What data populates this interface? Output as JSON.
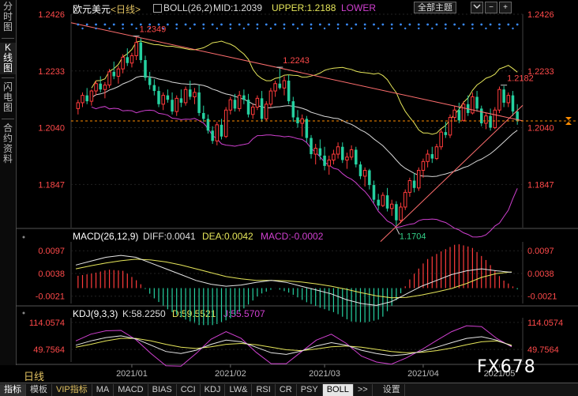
{
  "left_tabs": [
    {
      "label": "分时图",
      "active": false
    },
    {
      "label": "K线图",
      "active": true
    },
    {
      "label": "闪电图",
      "active": false
    },
    {
      "label": "合约资料",
      "active": false
    }
  ],
  "header": {
    "symbol": "欧元美元",
    "period": "<日线>",
    "indicator": "BOLL(26,2)",
    "mid_label": "MID:1.2039",
    "upper_label": "UPPER:1.2188",
    "lower_label": "LOWER",
    "theme_button": "全部主题",
    "down_icon": "chevron-down-icon",
    "btn_minus": "−",
    "btn_plus": "+"
  },
  "macd_header": {
    "name": "MACD(26,12,9)",
    "diff": "DIFF:0.0041",
    "dea": "DEA:0.0042",
    "macd": "MACD:-0.0002"
  },
  "kdj_header": {
    "name": "KDJ(9,3,3)",
    "k": "K:58.2250",
    "d": "D:59.5521",
    "j": "J:55.5707"
  },
  "footer": {
    "period": "日线",
    "tabs": [
      "指标",
      "模板",
      "VIP指标",
      "MA",
      "MACD",
      "BIAS",
      "CCI",
      "KDJ",
      "LW&",
      "RSI",
      "CR",
      "PSY",
      "BOLL",
      ">>",
      "设置"
    ],
    "active_tab": "BOLL"
  },
  "watermark": "FX678",
  "colors": {
    "up": "#ff3b3b",
    "down": "#25d0a0",
    "upper": "#e6e65a",
    "mid": "#d8d8d8",
    "lower": "#d040d0",
    "trend": "#ff6e6e",
    "price_line": "#ff8c00",
    "label_red": "#ff4a4a",
    "label_green": "#33d088",
    "dea": "#e6e65a",
    "diff": "#e6e6e6",
    "kdj_k": "#e6e6e6",
    "kdj_d": "#e6e65a",
    "kdj_j": "#d040d0"
  },
  "chart_data": [
    {
      "type": "candlestick",
      "title": "欧元美元 <日线>",
      "ylim": [
        1.17,
        1.2426
      ],
      "y_ticks": [
        1.2426,
        1.2233,
        1.204,
        1.1847
      ],
      "x_ticks": [
        "2021/01",
        "2021/02",
        "2021/03",
        "2021/04",
        "2021/05"
      ],
      "current_price": 1.2063,
      "annotations": [
        {
          "text": "1.2349",
          "value": 1.2349,
          "kind": "high"
        },
        {
          "text": "1.2243",
          "value": 1.2243,
          "kind": "high"
        },
        {
          "text": "1.2182",
          "value": 1.2182,
          "kind": "high"
        },
        {
          "text": "1.1704",
          "value": 1.1704,
          "kind": "low"
        }
      ],
      "ohlc": [
        [
          1.2105,
          1.2135,
          1.2085,
          1.2125
        ],
        [
          1.2125,
          1.216,
          1.211,
          1.215
        ],
        [
          1.215,
          1.2175,
          1.212,
          1.213
        ],
        [
          1.213,
          1.217,
          1.2115,
          1.2165
        ],
        [
          1.2165,
          1.22,
          1.215,
          1.219
        ],
        [
          1.219,
          1.2215,
          1.216,
          1.217
        ],
        [
          1.217,
          1.2195,
          1.214,
          1.2185
        ],
        [
          1.2185,
          1.224,
          1.2175,
          1.223
        ],
        [
          1.223,
          1.2265,
          1.2205,
          1.2215
        ],
        [
          1.2215,
          1.225,
          1.219,
          1.224
        ],
        [
          1.224,
          1.229,
          1.2225,
          1.228
        ],
        [
          1.228,
          1.231,
          1.225,
          1.226
        ],
        [
          1.226,
          1.2295,
          1.2245,
          1.2285
        ],
        [
          1.2285,
          1.2349,
          1.227,
          1.233
        ],
        [
          1.233,
          1.2345,
          1.226,
          1.227
        ],
        [
          1.227,
          1.2285,
          1.22,
          1.221
        ],
        [
          1.221,
          1.223,
          1.217,
          1.2185
        ],
        [
          1.2185,
          1.2205,
          1.215,
          1.2165
        ],
        [
          1.2165,
          1.218,
          1.211,
          1.212
        ],
        [
          1.212,
          1.216,
          1.21,
          1.215
        ],
        [
          1.215,
          1.217,
          1.2125,
          1.2135
        ],
        [
          1.2135,
          1.216,
          1.2085,
          1.2095
        ],
        [
          1.2095,
          1.215,
          1.208,
          1.214
        ],
        [
          1.214,
          1.217,
          1.211,
          1.2125
        ],
        [
          1.2125,
          1.218,
          1.2115,
          1.217
        ],
        [
          1.217,
          1.22,
          1.2135,
          1.2145
        ],
        [
          1.2145,
          1.2175,
          1.212,
          1.216
        ],
        [
          1.216,
          1.2185,
          1.208,
          1.209
        ],
        [
          1.209,
          1.2115,
          1.206,
          1.207
        ],
        [
          1.207,
          1.2085,
          1.202,
          1.203
        ],
        [
          1.203,
          1.2045,
          1.1985,
          1.1995
        ],
        [
          1.1995,
          1.206,
          1.198,
          1.205
        ],
        [
          1.205,
          1.207,
          1.2,
          1.201
        ],
        [
          1.201,
          1.211,
          1.2005,
          1.21
        ],
        [
          1.21,
          1.2145,
          1.2085,
          1.2135
        ],
        [
          1.2135,
          1.2155,
          1.2095,
          1.2105
        ],
        [
          1.2105,
          1.2165,
          1.2095,
          1.215
        ],
        [
          1.215,
          1.217,
          1.212,
          1.2135
        ],
        [
          1.2135,
          1.2155,
          1.2075,
          1.2085
        ],
        [
          1.2085,
          1.212,
          1.207,
          1.211
        ],
        [
          1.211,
          1.215,
          1.21,
          1.214
        ],
        [
          1.214,
          1.2165,
          1.206,
          1.207
        ],
        [
          1.207,
          1.213,
          1.2065,
          1.212
        ],
        [
          1.212,
          1.2175,
          1.211,
          1.2165
        ],
        [
          1.2165,
          1.22,
          1.2145,
          1.219
        ],
        [
          1.219,
          1.2243,
          1.217,
          1.2175
        ],
        [
          1.2175,
          1.2215,
          1.215,
          1.22
        ],
        [
          1.22,
          1.222,
          1.212,
          1.213
        ],
        [
          1.213,
          1.2145,
          1.206,
          1.2075
        ],
        [
          1.2075,
          1.21,
          1.204,
          1.2055
        ],
        [
          1.2055,
          1.2085,
          1.201,
          1.207
        ],
        [
          1.207,
          1.208,
          1.199,
          1.2005
        ],
        [
          1.2005,
          1.2015,
          1.1935,
          1.195
        ],
        [
          1.195,
          1.1985,
          1.1915,
          1.197
        ],
        [
          1.197,
          1.2,
          1.193,
          1.1945
        ],
        [
          1.1945,
          1.1975,
          1.1895,
          1.191
        ],
        [
          1.191,
          1.1945,
          1.188,
          1.193
        ],
        [
          1.193,
          1.1965,
          1.1915,
          1.195
        ],
        [
          1.195,
          1.199,
          1.1935,
          1.1975
        ],
        [
          1.1975,
          1.199,
          1.192,
          1.193
        ],
        [
          1.193,
          1.1955,
          1.19,
          1.194
        ],
        [
          1.194,
          1.198,
          1.193,
          1.1965
        ],
        [
          1.1965,
          1.1975,
          1.1905,
          1.1915
        ],
        [
          1.1915,
          1.1925,
          1.1865,
          1.1875
        ],
        [
          1.1875,
          1.1905,
          1.184,
          1.1895
        ],
        [
          1.1895,
          1.19,
          1.183,
          1.1845
        ],
        [
          1.1845,
          1.186,
          1.1785,
          1.1795
        ],
        [
          1.1795,
          1.1815,
          1.176,
          1.1775
        ],
        [
          1.1775,
          1.182,
          1.177,
          1.181
        ],
        [
          1.181,
          1.1835,
          1.1755,
          1.1765
        ],
        [
          1.1765,
          1.1795,
          1.174,
          1.178
        ],
        [
          1.178,
          1.179,
          1.1704,
          1.1725
        ],
        [
          1.1725,
          1.1785,
          1.1715,
          1.177
        ],
        [
          1.177,
          1.183,
          1.176,
          1.182
        ],
        [
          1.182,
          1.187,
          1.1805,
          1.186
        ],
        [
          1.186,
          1.1885,
          1.182,
          1.1835
        ],
        [
          1.1835,
          1.1905,
          1.1825,
          1.1895
        ],
        [
          1.1895,
          1.1935,
          1.187,
          1.1925
        ],
        [
          1.1925,
          1.1965,
          1.1905,
          1.195
        ],
        [
          1.195,
          1.1975,
          1.192,
          1.1935
        ],
        [
          1.1935,
          1.1985,
          1.193,
          1.1975
        ],
        [
          1.1975,
          1.2035,
          1.1965,
          1.2025
        ],
        [
          1.2025,
          1.206,
          1.2005,
          1.2015
        ],
        [
          1.2015,
          1.2085,
          1.2005,
          1.2075
        ],
        [
          1.2075,
          1.2115,
          1.206,
          1.21
        ],
        [
          1.21,
          1.2125,
          1.2055,
          1.2065
        ],
        [
          1.2065,
          1.213,
          1.206,
          1.212
        ],
        [
          1.212,
          1.215,
          1.208,
          1.209
        ],
        [
          1.209,
          1.216,
          1.2085,
          1.2145
        ],
        [
          1.2145,
          1.2165,
          1.2095,
          1.2105
        ],
        [
          1.2105,
          1.2115,
          1.2045,
          1.2055
        ],
        [
          1.2055,
          1.209,
          1.2035,
          1.208
        ],
        [
          1.208,
          1.2105,
          1.203,
          1.204
        ],
        [
          1.204,
          1.211,
          1.2035,
          1.21
        ],
        [
          1.21,
          1.218,
          1.209,
          1.217
        ],
        [
          1.217,
          1.2182,
          1.211,
          1.2125
        ],
        [
          1.2125,
          1.216,
          1.211,
          1.215
        ],
        [
          1.215,
          1.2165,
          1.208,
          1.2095
        ],
        [
          1.2095,
          1.212,
          1.205,
          1.2063
        ]
      ]
    },
    {
      "type": "line",
      "title": "MACD(26,12,9)",
      "ylim": [
        -0.004,
        0.012
      ],
      "y_ticks": [
        0.0097,
        0.0038,
        -0.0021
      ],
      "series": [
        {
          "name": "DIFF",
          "values": [
            0.006,
            0.007,
            0.008,
            0.0085,
            0.008,
            0.0065,
            0.005,
            0.0035,
            0.002,
            0.001,
            0.0005,
            0.0008,
            0.0015,
            0.002,
            0.0015,
            0.0005,
            -0.0005,
            -0.0015,
            -0.003,
            -0.004,
            -0.0045,
            -0.0035,
            -0.0015,
            0.0005,
            0.002,
            0.0035,
            0.0045,
            0.005,
            0.0045,
            0.0041
          ]
        },
        {
          "name": "DEA",
          "values": [
            0.005,
            0.0058,
            0.0065,
            0.0071,
            0.0075,
            0.0073,
            0.0068,
            0.006,
            0.005,
            0.004,
            0.003,
            0.0024,
            0.002,
            0.002,
            0.0019,
            0.0016,
            0.0011,
            0.0005,
            -0.0003,
            -0.0012,
            -0.002,
            -0.0025,
            -0.0024,
            -0.0018,
            -0.001,
            -0.0001,
            0.0012,
            0.0028,
            0.0038,
            0.0042
          ]
        }
      ]
    },
    {
      "type": "line",
      "title": "KDJ(9,3,3)",
      "ylim": [
        20,
        125
      ],
      "y_ticks": [
        114.0574,
        49.7564
      ],
      "series": [
        {
          "name": "K",
          "values": [
            60,
            70,
            78,
            82,
            75,
            60,
            45,
            40,
            48,
            62,
            72,
            68,
            55,
            42,
            38,
            46,
            58,
            66,
            60,
            48,
            40,
            35,
            38,
            45,
            55,
            66,
            76,
            80,
            72,
            58
          ]
        },
        {
          "name": "D",
          "values": [
            55,
            62,
            70,
            76,
            76,
            70,
            62,
            55,
            52,
            56,
            62,
            64,
            61,
            55,
            49,
            47,
            51,
            56,
            58,
            55,
            50,
            45,
            42,
            43,
            47,
            53,
            61,
            68,
            70,
            60
          ]
        },
        {
          "name": "J",
          "values": [
            70,
            86,
            94,
            95,
            73,
            40,
            11,
            10,
            40,
            74,
            92,
            76,
            43,
            16,
            16,
            44,
            72,
            86,
            64,
            34,
            20,
            15,
            30,
            49,
            71,
            92,
            106,
            104,
            76,
            56
          ]
        }
      ]
    }
  ]
}
